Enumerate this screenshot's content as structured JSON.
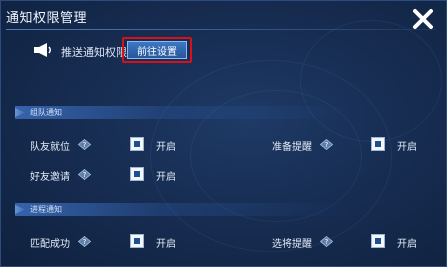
{
  "window": {
    "title": "通知权限管理"
  },
  "push": {
    "label": "推送通知权限",
    "button_label": "前往设置"
  },
  "sections": [
    {
      "header": "组队通知",
      "items": [
        {
          "label": "队友就位",
          "state": "开启"
        },
        {
          "label": "准备提醒",
          "state": "开启"
        },
        {
          "label": "好友邀请",
          "state": "开启"
        }
      ]
    },
    {
      "header": "进程通知",
      "items": [
        {
          "label": "匹配成功",
          "state": "开启"
        },
        {
          "label": "选将提醒",
          "state": "开启"
        }
      ]
    }
  ],
  "icons": {
    "close": "close-icon",
    "megaphone": "megaphone-icon",
    "help": "help-diamond-icon"
  },
  "colors": {
    "background": "#172d52",
    "highlight_border": "#d8101a",
    "button": "#3d78c4",
    "checkbox_mark": "#1f4f93"
  }
}
